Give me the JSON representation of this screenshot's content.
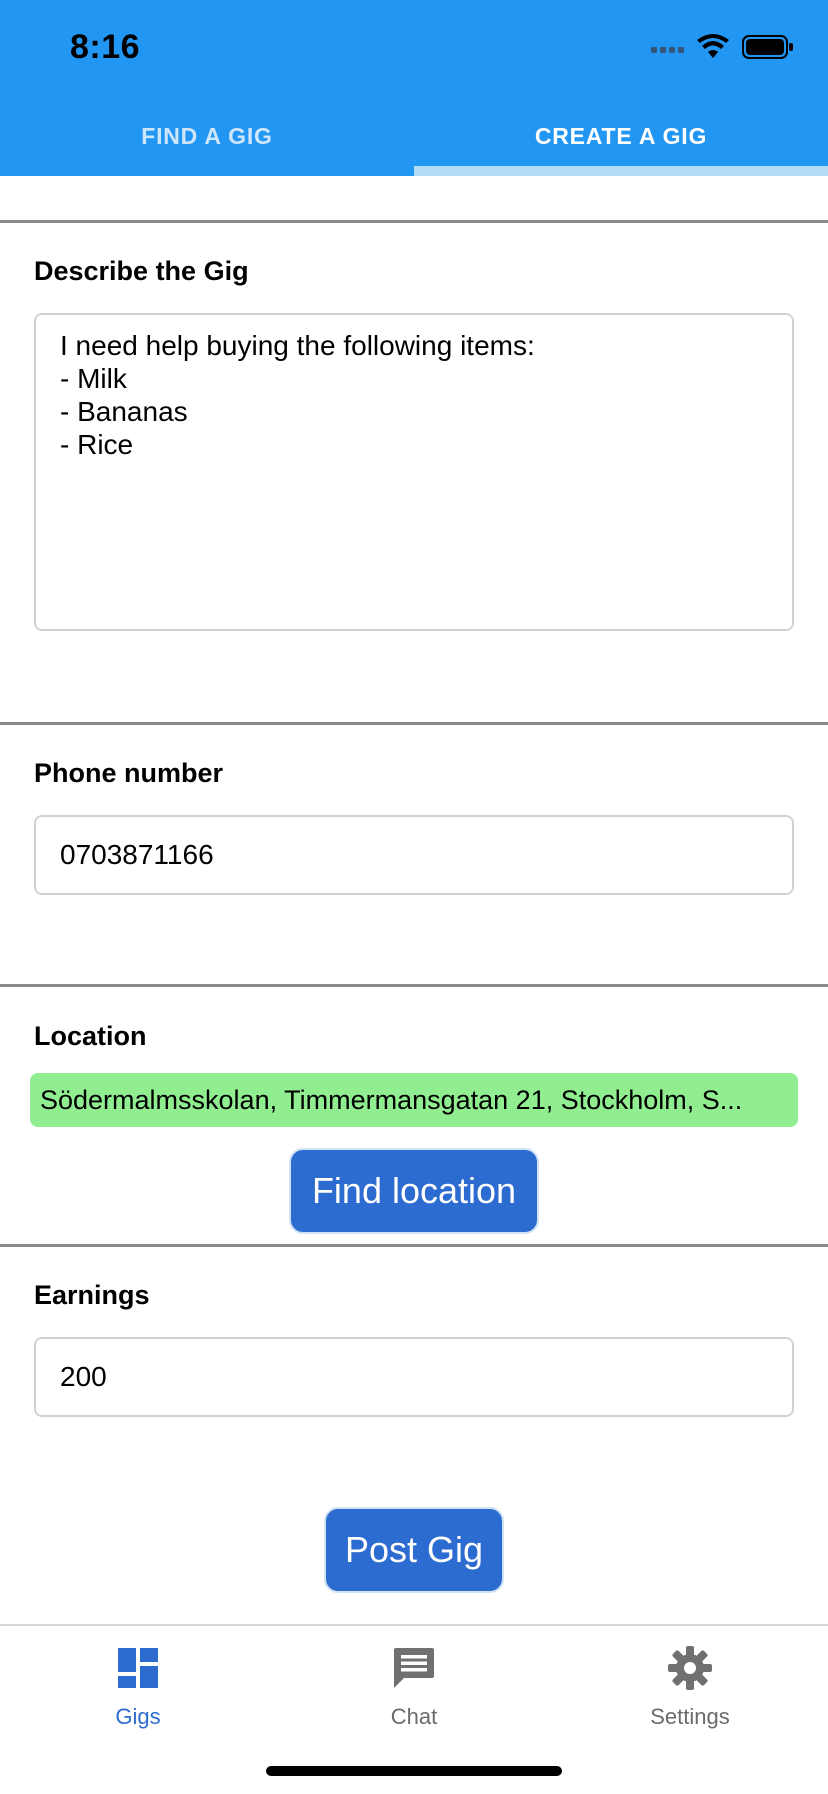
{
  "status_bar": {
    "time": "8:16"
  },
  "top_tabs": [
    {
      "label": "FIND A GIG",
      "active": false
    },
    {
      "label": "CREATE A GIG",
      "active": true
    }
  ],
  "form": {
    "describe": {
      "label": "Describe the Gig",
      "lines": [
        "I need help buying the following items:",
        "- Milk",
        "- Bananas",
        "- Rice"
      ]
    },
    "phone": {
      "label": "Phone number",
      "value": "0703871166"
    },
    "location": {
      "label": "Location",
      "value": "Södermalmsskolan, Timmermansgatan 21, Stockholm, S...",
      "find_button": "Find location"
    },
    "earnings": {
      "label": "Earnings",
      "value": "200"
    },
    "post_button": "Post Gig"
  },
  "bottom_nav": [
    {
      "label": "Gigs",
      "icon": "dashboard-icon",
      "active": true
    },
    {
      "label": "Chat",
      "icon": "chat-icon",
      "active": false
    },
    {
      "label": "Settings",
      "icon": "gear-icon",
      "active": false
    }
  ],
  "colors": {
    "header_blue": "#2196f3",
    "button_blue": "#2c6bcf",
    "location_green": "#90ee90"
  }
}
